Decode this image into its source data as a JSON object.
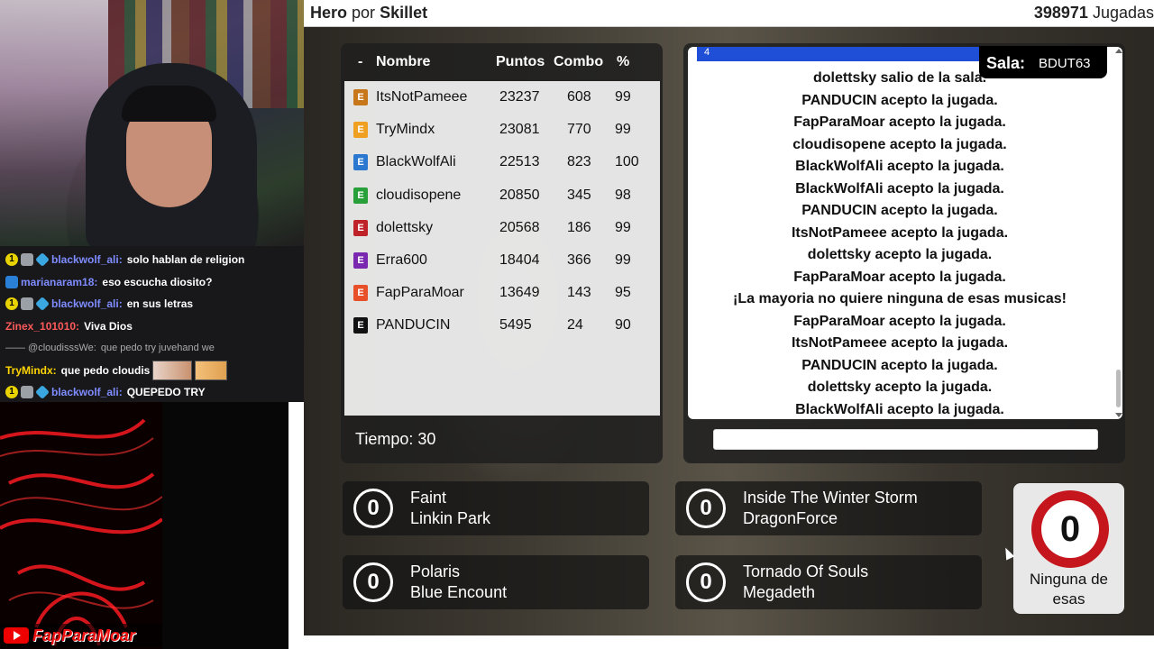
{
  "header": {
    "song_title": "Hero",
    "by_label": "por",
    "artist": "Skillet",
    "plays_count": "398971",
    "plays_label": "Jugadas"
  },
  "scoreboard": {
    "columns": {
      "rank": "-",
      "name": "Nombre",
      "points": "Puntos",
      "combo": "Combo",
      "percent": "%"
    },
    "rows": [
      {
        "badge": "E",
        "badge_color": "#c8761a",
        "name": "ItsNotPameee",
        "points": "23237",
        "combo": "608",
        "percent": "99"
      },
      {
        "badge": "E",
        "badge_color": "#f0a020",
        "name": "TryMindx",
        "points": "23081",
        "combo": "770",
        "percent": "99"
      },
      {
        "badge": "E",
        "badge_color": "#2a78d0",
        "name": "BlackWolfAli",
        "points": "22513",
        "combo": "823",
        "percent": "100"
      },
      {
        "badge": "E",
        "badge_color": "#28a03a",
        "name": "cloudisopene",
        "points": "20850",
        "combo": "345",
        "percent": "98"
      },
      {
        "badge": "E",
        "badge_color": "#c0222a",
        "name": "dolettsky",
        "points": "20568",
        "combo": "186",
        "percent": "99"
      },
      {
        "badge": "E",
        "badge_color": "#7a28b0",
        "name": "Erra600",
        "points": "18404",
        "combo": "366",
        "percent": "99"
      },
      {
        "badge": "E",
        "badge_color": "#e8502a",
        "name": "FapParaMoar",
        "points": "13649",
        "combo": "143",
        "percent": "95"
      },
      {
        "badge": "E",
        "badge_color": "#111111",
        "name": "PANDUCIN",
        "points": "5495",
        "combo": "24",
        "percent": "90"
      }
    ],
    "timer": "Tiempo: 30"
  },
  "room": {
    "label": "Sala:",
    "code": "BDUT63"
  },
  "log": {
    "top_fragment": "4",
    "lines": [
      "dolettsky salio de la sala.",
      "PANDUCIN acepto la jugada.",
      "FapParaMoar acepto la jugada.",
      "cloudisopene acepto la jugada.",
      "BlackWolfAli acepto la jugada.",
      "BlackWolfAli acepto la jugada.",
      "PANDUCIN acepto la jugada.",
      "ItsNotPameee acepto la jugada.",
      "dolettsky acepto la jugada.",
      "FapParaMoar acepto la jugada.",
      "¡La mayoria no quiere ninguna de esas musicas!",
      "FapParaMoar acepto la jugada.",
      "ItsNotPameee acepto la jugada.",
      "PANDUCIN acepto la jugada.",
      "dolettsky acepto la jugada.",
      "BlackWolfAli acepto la jugada."
    ]
  },
  "options": [
    {
      "votes": "0",
      "title": "Faint",
      "artist": "Linkin Park"
    },
    {
      "votes": "0",
      "title": "Inside The Winter Storm",
      "artist": "DragonForce"
    },
    {
      "votes": "0",
      "title": "Polaris",
      "artist": "Blue Encount"
    },
    {
      "votes": "0",
      "title": "Tornado Of Souls",
      "artist": "Megadeth"
    }
  ],
  "none_option": {
    "votes": "0",
    "label": "Ninguna de esas"
  },
  "stream_chat": [
    {
      "user": "blackwolf_ali:",
      "color": "#7f8cff",
      "message": "solo hablan de religion",
      "badges": [
        "b1",
        "b2",
        "b3"
      ]
    },
    {
      "user": "marianaram18:",
      "color": "#7f8cff",
      "message": "eso escucha diosito?",
      "badges": [
        "b4"
      ]
    },
    {
      "user": "blackwolf_ali:",
      "color": "#7f8cff",
      "message": "en sus letras",
      "badges": [
        "b1",
        "b2",
        "b3"
      ]
    },
    {
      "user": "Zinex_101010:",
      "color": "#ff5a5a",
      "message": "Viva Dios",
      "badges": []
    },
    {
      "user": "—— @cloudisssWe:",
      "color": "#aaaaaa",
      "message": "que pedo try juvehand we",
      "badges": [],
      "dim": true
    },
    {
      "user": "TryMindx:",
      "color": "#ffd400",
      "message": "que pedo cloudis",
      "badges": [],
      "emotes": true
    },
    {
      "user": "blackwolf_ali:",
      "color": "#7f8cff",
      "message": "QUEPEDO TRY",
      "badges": [
        "b1",
        "b2",
        "b3"
      ]
    }
  ],
  "overlay": {
    "brand_text": "FapParaMoar"
  },
  "colors": {
    "option_bg": "#141414",
    "none_ring": "#c4161c",
    "log_header": "#1f4fd6"
  }
}
